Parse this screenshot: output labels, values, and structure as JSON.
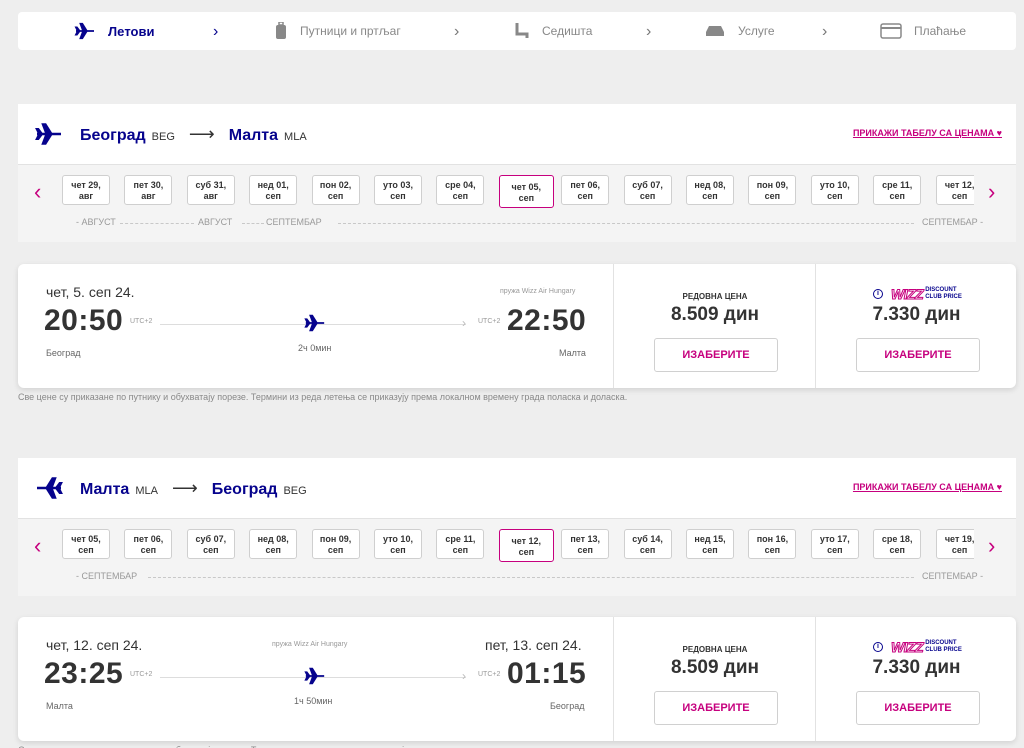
{
  "steps": [
    {
      "label": "Лeтови",
      "icon": "plane-icon",
      "active": true
    },
    {
      "label": "Путници и пртљаг",
      "icon": "luggage-icon",
      "active": false
    },
    {
      "label": "Седишта",
      "icon": "seat-icon",
      "active": false
    },
    {
      "label": "Услуге",
      "icon": "car-icon",
      "active": false
    },
    {
      "label": "Плаћање",
      "icon": "card-icon",
      "active": false
    }
  ],
  "colors": {
    "brand": "#06038d",
    "accent": "#c6007e"
  },
  "outbound": {
    "from_city": "Београд",
    "from_code": "BEG",
    "to_city": "Малта",
    "to_code": "MLA",
    "price_table_link": "ПРИКАЖИ ТАБЕЛУ СА ЦЕНАМА ♥",
    "dates": [
      {
        "d": "чет 29,",
        "m": "авг"
      },
      {
        "d": "пет 30,",
        "m": "авг"
      },
      {
        "d": "суб 31,",
        "m": "авг"
      },
      {
        "d": "нед 01,",
        "m": "сеп"
      },
      {
        "d": "пон 02,",
        "m": "сеп"
      },
      {
        "d": "уто 03,",
        "m": "сеп"
      },
      {
        "d": "сре 04,",
        "m": "сеп"
      },
      {
        "d": "чет 05,",
        "m": "сеп"
      },
      {
        "d": "пет 06,",
        "m": "сеп"
      },
      {
        "d": "суб 07,",
        "m": "сеп"
      },
      {
        "d": "нед 08,",
        "m": "сеп"
      },
      {
        "d": "пон 09,",
        "m": "сеп"
      },
      {
        "d": "уто 10,",
        "m": "сеп"
      },
      {
        "d": "сре 11,",
        "m": "сеп"
      },
      {
        "d": "чет 12,",
        "m": "сеп"
      }
    ],
    "selected_index": 7,
    "months": [
      "- АВГУСТ",
      "АВГУСТ",
      "СЕПТЕМБАР",
      "СЕПТЕМБАР -"
    ],
    "fare": {
      "date_label": "чет, 5. сеп 24.",
      "operated_by": "пружа Wizz Air Hungary",
      "dep_time": "20:50",
      "dep_utc": "UTC+2",
      "arr_time": "22:50",
      "arr_utc": "UTC+2",
      "duration": "2ч 0мин",
      "dep_city": "Београд",
      "arr_city": "Малта",
      "regular_label": "РЕДОВНА ЦЕНА",
      "regular_price": "8.509 дин",
      "club_price": "7.330 дин",
      "select_label": "ИЗАБЕРИТЕ",
      "club_logo": "WIZZ",
      "club_text_1": "DISCOUNT",
      "club_text_2": "CLUB PRICE"
    }
  },
  "disclaimer": "Све цене су приказане по путнику и обухватају порезе. Термини из реда летења се приказују према локалном времену града поласка и доласка.",
  "inbound": {
    "from_city": "Малта",
    "from_code": "MLA",
    "to_city": "Београд",
    "to_code": "BEG",
    "price_table_link": "ПРИКАЖИ ТАБЕЛУ СА ЦЕНАМА ♥",
    "dates": [
      {
        "d": "чет 05,",
        "m": "сеп"
      },
      {
        "d": "пет 06,",
        "m": "сеп"
      },
      {
        "d": "суб 07,",
        "m": "сеп"
      },
      {
        "d": "нед 08,",
        "m": "сеп"
      },
      {
        "d": "пон 09,",
        "m": "сеп"
      },
      {
        "d": "уто 10,",
        "m": "сеп"
      },
      {
        "d": "сре 11,",
        "m": "сеп"
      },
      {
        "d": "чет 12,",
        "m": "сеп"
      },
      {
        "d": "пет 13,",
        "m": "сеп"
      },
      {
        "d": "суб 14,",
        "m": "сеп"
      },
      {
        "d": "нед 15,",
        "m": "сеп"
      },
      {
        "d": "пон 16,",
        "m": "сеп"
      },
      {
        "d": "уто 17,",
        "m": "сеп"
      },
      {
        "d": "сре 18,",
        "m": "сеп"
      },
      {
        "d": "чет 19,",
        "m": "сеп"
      }
    ],
    "selected_index": 7,
    "months": [
      "- СЕПТЕМБАР",
      "СЕПТЕМБАР -"
    ],
    "fare": {
      "dep_date_label": "чет, 12. сеп 24.",
      "arr_date_label": "пет, 13. сеп 24.",
      "operated_by": "пружа Wizz Air Hungary",
      "dep_time": "23:25",
      "dep_utc": "UTC+2",
      "arr_time": "01:15",
      "arr_utc": "UTC+2",
      "duration": "1ч 50мин",
      "dep_city": "Малта",
      "arr_city": "Београд",
      "regular_label": "РЕДОВНА ЦЕНА",
      "regular_price": "8.509 дин",
      "club_price": "7.330 дин",
      "select_label": "ИЗАБЕРИТЕ",
      "club_logo": "WIZZ",
      "club_text_1": "DISCOUNT",
      "club_text_2": "CLUB PRICE"
    }
  }
}
